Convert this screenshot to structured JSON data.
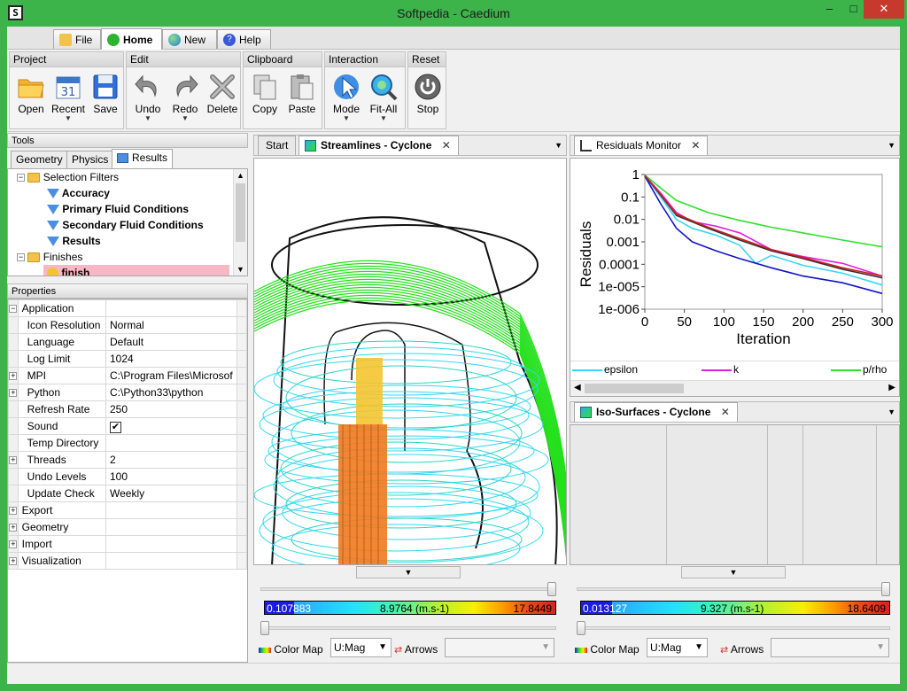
{
  "window": {
    "title": "Softpedia - Caedium",
    "min": "–",
    "max": "□",
    "close": "✕"
  },
  "menu_tabs": [
    {
      "label": "File",
      "icon": "folder-icon"
    },
    {
      "label": "Home",
      "icon": "home-icon"
    },
    {
      "label": "New",
      "icon": "globe-icon"
    },
    {
      "label": "Help",
      "icon": "help-icon"
    }
  ],
  "ribbon": {
    "groups": {
      "project": {
        "label": "Project",
        "buttons": [
          "Open",
          "Recent",
          "Save"
        ]
      },
      "edit": {
        "label": "Edit",
        "buttons": [
          "Undo",
          "Redo",
          "Delete"
        ]
      },
      "clipboard": {
        "label": "Clipboard",
        "buttons": [
          "Copy",
          "Paste"
        ]
      },
      "interaction": {
        "label": "Interaction",
        "buttons": [
          "Mode",
          "Fit-All"
        ]
      },
      "reset": {
        "label": "Reset",
        "buttons": [
          "Stop"
        ]
      }
    }
  },
  "tools": {
    "title": "Tools",
    "tabs": [
      "Geometry",
      "Physics",
      "Results"
    ],
    "tree": [
      {
        "label": "Selection Filters",
        "type": "folder",
        "expander": "−"
      },
      {
        "label": "Accuracy",
        "type": "filter"
      },
      {
        "label": "Primary Fluid Conditions",
        "type": "filter"
      },
      {
        "label": "Secondary Fluid Conditions",
        "type": "filter"
      },
      {
        "label": "Results",
        "type": "filter"
      },
      {
        "label": "Finishes",
        "type": "folder",
        "expander": "−"
      },
      {
        "label": "finish",
        "type": "finish"
      }
    ]
  },
  "properties": {
    "title": "Properties",
    "rows": [
      {
        "expander": "−",
        "key": "Application",
        "value": ""
      },
      {
        "expander": "",
        "key": "Icon Resolution",
        "value": "Normal"
      },
      {
        "expander": "",
        "key": "Language",
        "value": "Default"
      },
      {
        "expander": "",
        "key": "Log Limit",
        "value": "1024"
      },
      {
        "expander": "+",
        "key": "MPI",
        "value": "C:\\Program Files\\Microsof"
      },
      {
        "expander": "+",
        "key": "Python",
        "value": "C:\\Python33\\python"
      },
      {
        "expander": "",
        "key": "Refresh Rate",
        "value": "250"
      },
      {
        "expander": "",
        "key": "Sound",
        "value": "✔"
      },
      {
        "expander": "",
        "key": "Temp Directory",
        "value": ""
      },
      {
        "expander": "+",
        "key": "Threads",
        "value": "2"
      },
      {
        "expander": "",
        "key": "Undo Levels",
        "value": "100"
      },
      {
        "expander": "",
        "key": "Update Check",
        "value": "Weekly"
      },
      {
        "expander": "+",
        "key": "Export",
        "value": ""
      },
      {
        "expander": "+",
        "key": "Geometry",
        "value": ""
      },
      {
        "expander": "+",
        "key": "Import",
        "value": ""
      },
      {
        "expander": "+",
        "key": "Visualization",
        "value": ""
      }
    ]
  },
  "center_view": {
    "tabs": [
      "Start",
      "Streamlines - Cyclone"
    ],
    "colorbar": {
      "min": "0.107883",
      "mid": "8.9764 (m.s-1)",
      "max": "17.8449"
    },
    "color_map_label": "Color Map",
    "color_map_value": "U:Mag",
    "arrows_label": "Arrows"
  },
  "residuals": {
    "tab": "Residuals Monitor",
    "legend": [
      "epsilon",
      "k",
      "p/rho"
    ],
    "colors": {
      "epsilon": "#38d6f2",
      "k": "#e020e0",
      "p_rho": "#2ee02e",
      "blue": "#1414c8",
      "red": "#cc1f1f",
      "dark": "#303030"
    }
  },
  "isosurfaces": {
    "tab": "Iso-Surfaces - Cyclone",
    "colorbar": {
      "min": "0.013127",
      "mid": "9.327 (m.s-1)",
      "max": "18.6409"
    },
    "color_map_label": "Color Map",
    "color_map_value": "U:Mag",
    "arrows_label": "Arrows"
  },
  "chart_data": {
    "type": "line",
    "xlabel": "Iteration",
    "ylabel": "Residuals",
    "xlim": [
      0,
      300
    ],
    "ylim": [
      1e-06,
      1
    ],
    "yscale": "log",
    "x_ticks": [
      "0",
      "50",
      "100",
      "150",
      "200",
      "250",
      "300"
    ],
    "y_ticks": [
      "1",
      "0.1",
      "0.01",
      "0.001",
      "0.0001",
      "1e-005",
      "1e-006"
    ],
    "grid": false,
    "legend_position": "bottom",
    "series": [
      {
        "name": "epsilon",
        "x": [
          0,
          20,
          40,
          60,
          90,
          120,
          140,
          160,
          200,
          250,
          300
        ],
        "y": [
          0.9,
          0.1,
          0.01,
          0.004,
          0.002,
          0.0007,
          0.00011,
          0.00025,
          9e-05,
          4e-05,
          1.2e-05
        ]
      },
      {
        "name": "k",
        "x": [
          0,
          20,
          40,
          60,
          90,
          120,
          160,
          200,
          250,
          300
        ],
        "y": [
          0.9,
          0.15,
          0.02,
          0.008,
          0.005,
          0.0025,
          0.00045,
          0.00022,
          0.00011,
          3e-05
        ]
      },
      {
        "name": "p/rho",
        "x": [
          0,
          20,
          40,
          80,
          120,
          160,
          200,
          250,
          300
        ],
        "y": [
          0.95,
          0.25,
          0.07,
          0.02,
          0.009,
          0.0045,
          0.0025,
          0.0012,
          0.0006
        ]
      },
      {
        "x": [
          0,
          20,
          40,
          80,
          120,
          160,
          200,
          250,
          300
        ],
        "y": [
          0.9,
          0.12,
          0.015,
          0.004,
          0.0012,
          0.0004,
          0.00018,
          6e-05,
          2.5e-05
        ]
      },
      {
        "x": [
          0,
          20,
          40,
          60,
          90,
          120,
          160,
          200,
          250,
          300
        ],
        "y": [
          0.85,
          0.05,
          0.004,
          0.001,
          0.0004,
          0.00018,
          7e-05,
          3e-05,
          1.5e-05,
          5e-06
        ]
      },
      {
        "x": [
          0,
          20,
          40,
          80,
          120,
          160,
          200,
          250,
          300
        ],
        "y": [
          0.9,
          0.13,
          0.017,
          0.0045,
          0.0014,
          0.00045,
          0.0002,
          7e-05,
          3e-05
        ]
      }
    ]
  }
}
